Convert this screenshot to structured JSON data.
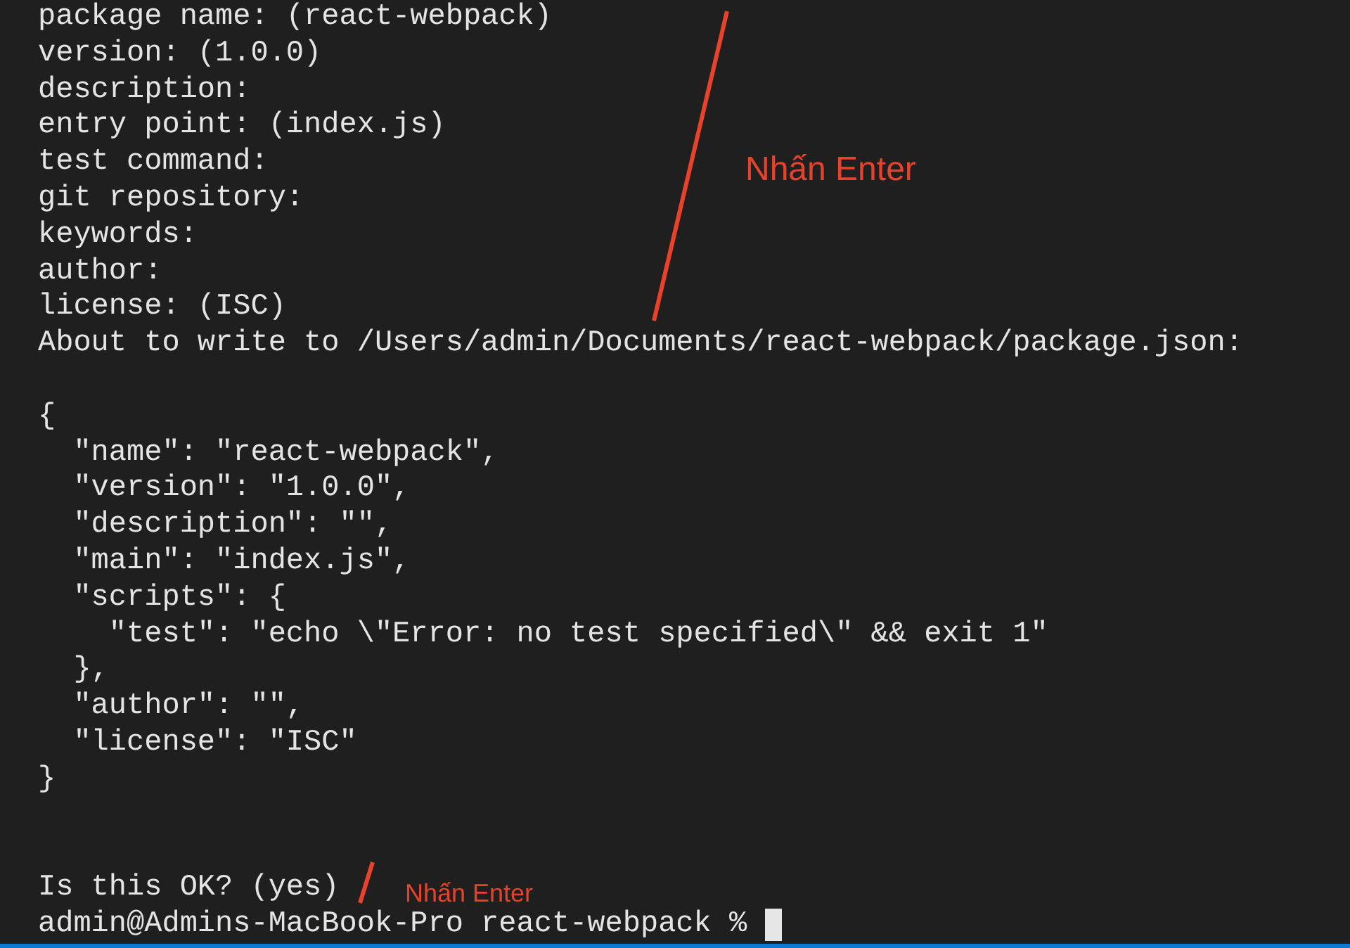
{
  "terminal": {
    "lines": [
      {
        "kind": "output",
        "text": "package name: (react-webpack)"
      },
      {
        "kind": "output",
        "text": "version: (1.0.0)"
      },
      {
        "kind": "output",
        "text": "description:"
      },
      {
        "kind": "output",
        "text": "entry point: (index.js)"
      },
      {
        "kind": "output",
        "text": "test command:"
      },
      {
        "kind": "output",
        "text": "git repository:"
      },
      {
        "kind": "output",
        "text": "keywords:"
      },
      {
        "kind": "output",
        "text": "author:"
      },
      {
        "kind": "output",
        "text": "license: (ISC)"
      },
      {
        "kind": "output",
        "text": "About to write to /Users/admin/Documents/react-webpack/package.json:"
      },
      {
        "kind": "blank"
      },
      {
        "kind": "output",
        "text": "{"
      },
      {
        "kind": "output",
        "text": "  \"name\": \"react-webpack\","
      },
      {
        "kind": "output",
        "text": "  \"version\": \"1.0.0\","
      },
      {
        "kind": "output",
        "text": "  \"description\": \"\","
      },
      {
        "kind": "output",
        "text": "  \"main\": \"index.js\","
      },
      {
        "kind": "output",
        "text": "  \"scripts\": {"
      },
      {
        "kind": "output",
        "text": "    \"test\": \"echo \\\"Error: no test specified\\\" && exit 1\""
      },
      {
        "kind": "output",
        "text": "  },"
      },
      {
        "kind": "output",
        "text": "  \"author\": \"\","
      },
      {
        "kind": "output",
        "text": "  \"license\": \"ISC\""
      },
      {
        "kind": "output",
        "text": "}"
      },
      {
        "kind": "blank"
      },
      {
        "kind": "blank"
      },
      {
        "kind": "output",
        "text": "Is this OK? (yes)"
      },
      {
        "kind": "prompt",
        "text": "admin@Admins-MacBook-Pro react-webpack % ",
        "cursor": true
      }
    ]
  },
  "annotations": [
    {
      "kind": "large",
      "text": "Nhấn Enter"
    },
    {
      "kind": "small",
      "text": "Nhấn Enter"
    }
  ]
}
